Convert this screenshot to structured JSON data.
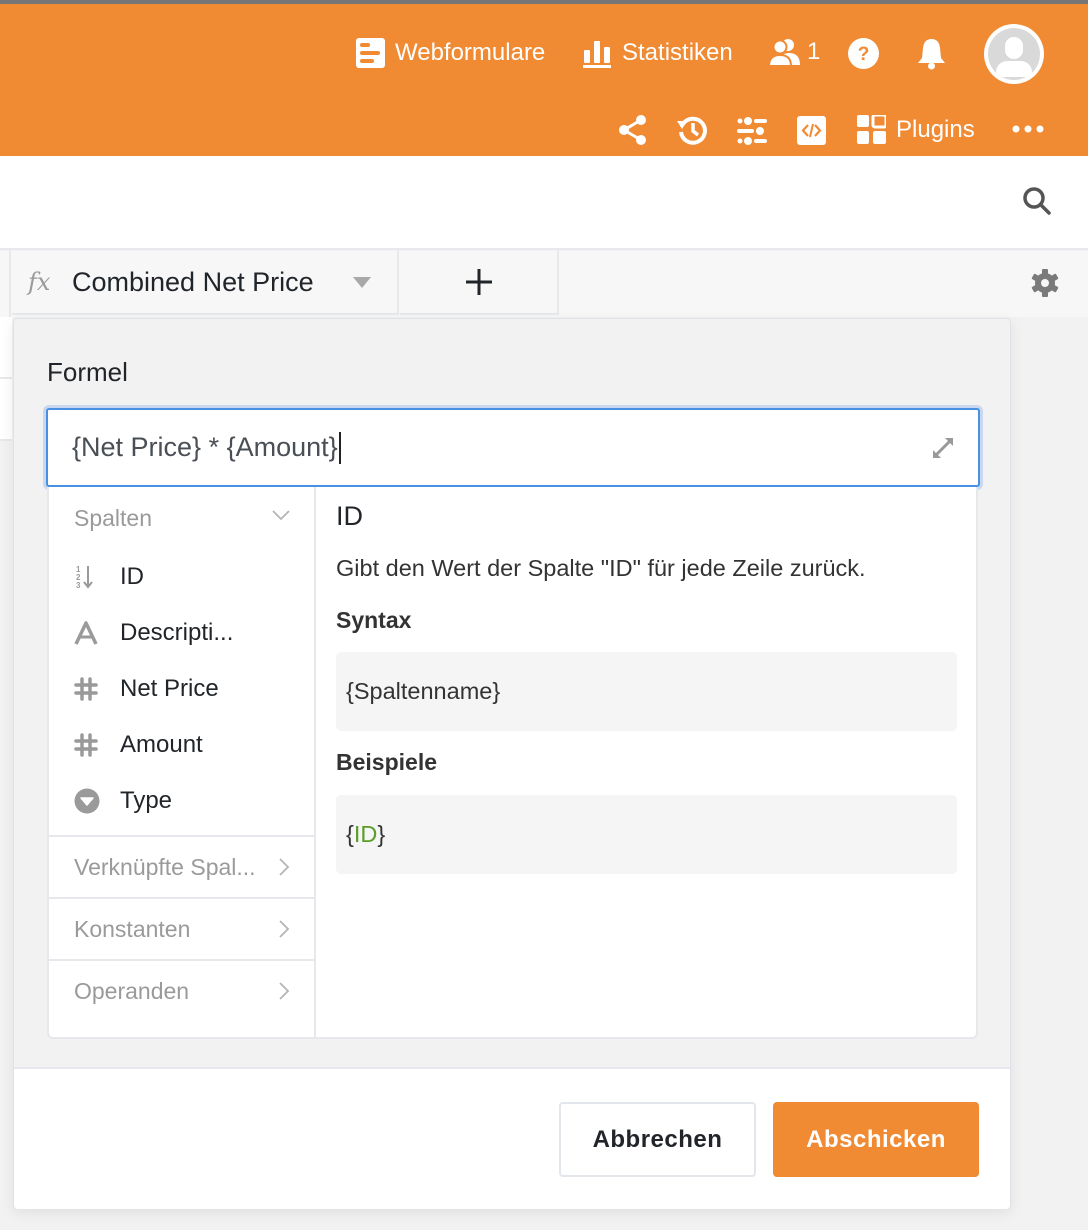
{
  "colors": {
    "brand": "#f08a33",
    "focus_border": "#4a90e2",
    "example_highlight": "#5a9d28"
  },
  "header": {
    "nav": [
      {
        "label": "Webformulare",
        "icon": "form-icon"
      },
      {
        "label": "Statistiken",
        "icon": "bar-chart-icon"
      }
    ],
    "collaborators": {
      "icon": "users-icon",
      "count": "1"
    },
    "help_icon": "help-circle-icon",
    "notifications_icon": "bell-icon",
    "avatar_icon": "user-avatar-icon",
    "toolbar": [
      {
        "icon": "share-icon"
      },
      {
        "icon": "history-icon"
      },
      {
        "icon": "sliders-icon"
      },
      {
        "icon": "code-icon"
      },
      {
        "icon": "plugins-icon",
        "label": "Plugins"
      },
      {
        "icon": "more-icon"
      }
    ]
  },
  "subbar": {
    "search_icon": "search-icon"
  },
  "column_bar": {
    "column": {
      "type_icon": "fx",
      "name": "Combined Net Price"
    },
    "add_label": "+",
    "settings_icon": "gear-icon"
  },
  "dialog": {
    "formula_label": "Formel",
    "formula_value": "{Net Price} * {Amount}",
    "sections": {
      "columns": {
        "title": "Spalten",
        "items": [
          {
            "icon": "number-sort-icon",
            "label": "ID"
          },
          {
            "icon": "text-icon",
            "label": "Descripti..."
          },
          {
            "icon": "hash-icon",
            "label": "Net Price"
          },
          {
            "icon": "hash-icon",
            "label": "Amount"
          },
          {
            "icon": "single-select-icon",
            "label": "Type"
          }
        ]
      },
      "linked": {
        "title": "Verknüpfte Spal..."
      },
      "constants": {
        "title": "Konstanten"
      },
      "operands": {
        "title": "Operanden"
      }
    },
    "detail": {
      "title": "ID",
      "description": "Gibt den Wert der Spalte \"ID\" für jede Zeile zurück.",
      "syntax_heading": "Syntax",
      "syntax": "{Spaltenname}",
      "examples_heading": "Beispiele",
      "example_open": "{",
      "example_value": "ID",
      "example_close": "}"
    },
    "buttons": {
      "cancel": "Abbrechen",
      "submit": "Abschicken"
    }
  }
}
